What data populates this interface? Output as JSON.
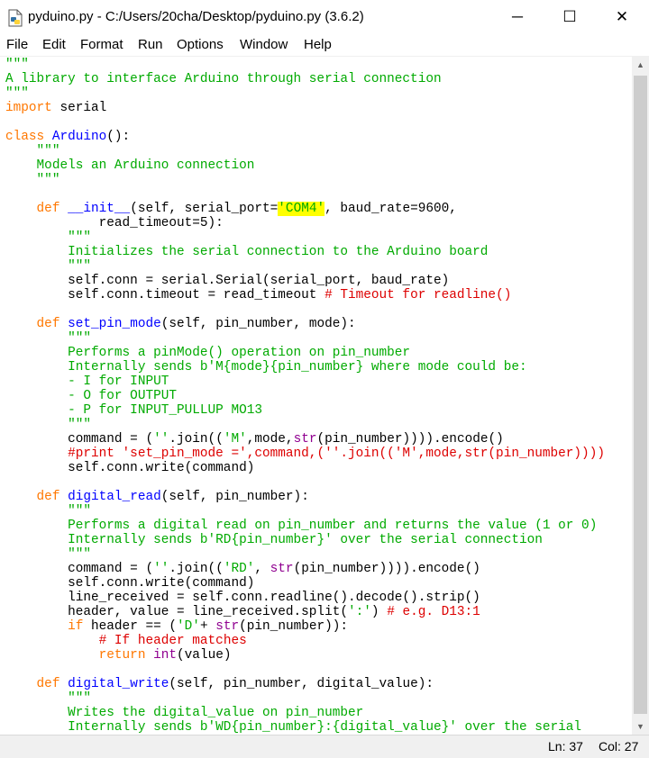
{
  "window": {
    "title": "pyduino.py - C:/Users/20cha/Desktop/pyduino.py (3.6.2)",
    "minimize": "─",
    "maximize": "☐",
    "close": "✕"
  },
  "menu": [
    "File",
    "Edit",
    "Format",
    "Run",
    "Options",
    "Window",
    "Help"
  ],
  "status": {
    "line": "Ln: 37",
    "col": "Col: 27"
  },
  "colors": {
    "string": "#00aa00",
    "keyword": "#ff7700",
    "definition": "#0000ff",
    "builtin": "#900090",
    "comment": "#dd0000",
    "highlight": "#ffff00"
  },
  "code_lines": [
    [
      [
        "s",
        "\"\"\""
      ]
    ],
    [
      [
        "s",
        "A library to interface Arduino through serial connection"
      ]
    ],
    [
      [
        "s",
        "\"\"\""
      ]
    ],
    [
      [
        "k",
        "import"
      ],
      [
        "n",
        " serial"
      ]
    ],
    [],
    [
      [
        "k",
        "class"
      ],
      [
        "n",
        " "
      ],
      [
        "d",
        "Arduino"
      ],
      [
        "n",
        "():"
      ]
    ],
    [
      [
        "n",
        "    "
      ],
      [
        "s",
        "\"\"\""
      ]
    ],
    [
      [
        "n",
        "    "
      ],
      [
        "s",
        "Models an Arduino connection"
      ]
    ],
    [
      [
        "n",
        "    "
      ],
      [
        "s",
        "\"\"\""
      ]
    ],
    [],
    [
      [
        "n",
        "    "
      ],
      [
        "k",
        "def"
      ],
      [
        "n",
        " "
      ],
      [
        "d",
        "__init__"
      ],
      [
        "n",
        "(self, serial_port="
      ],
      [
        "hs",
        "'COM4'"
      ],
      [
        "n",
        ", baud_rate=9600,"
      ]
    ],
    [
      [
        "n",
        "            read_timeout=5):"
      ]
    ],
    [
      [
        "n",
        "        "
      ],
      [
        "s",
        "\"\"\""
      ]
    ],
    [
      [
        "n",
        "        "
      ],
      [
        "s",
        "Initializes the serial connection to the Arduino board"
      ]
    ],
    [
      [
        "n",
        "        "
      ],
      [
        "s",
        "\"\"\""
      ]
    ],
    [
      [
        "n",
        "        self.conn = serial.Serial(serial_port, baud_rate)"
      ]
    ],
    [
      [
        "n",
        "        self.conn.timeout = read_timeout "
      ],
      [
        "c",
        "# Timeout for readline()"
      ]
    ],
    [],
    [
      [
        "n",
        "    "
      ],
      [
        "k",
        "def"
      ],
      [
        "n",
        " "
      ],
      [
        "d",
        "set_pin_mode"
      ],
      [
        "n",
        "(self, pin_number, mode):"
      ]
    ],
    [
      [
        "n",
        "        "
      ],
      [
        "s",
        "\"\"\""
      ]
    ],
    [
      [
        "n",
        "        "
      ],
      [
        "s",
        "Performs a pinMode() operation on pin_number"
      ]
    ],
    [
      [
        "n",
        "        "
      ],
      [
        "s",
        "Internally sends b'M{mode}{pin_number} where mode could be:"
      ]
    ],
    [
      [
        "n",
        "        "
      ],
      [
        "s",
        "- I for INPUT"
      ]
    ],
    [
      [
        "n",
        "        "
      ],
      [
        "s",
        "- O for OUTPUT"
      ]
    ],
    [
      [
        "n",
        "        "
      ],
      [
        "s",
        "- P for INPUT_PULLUP MO13"
      ]
    ],
    [
      [
        "n",
        "        "
      ],
      [
        "s",
        "\"\"\""
      ]
    ],
    [
      [
        "n",
        "        command = ("
      ],
      [
        "s",
        "''"
      ],
      [
        "n",
        ".join(("
      ],
      [
        "s",
        "'M'"
      ],
      [
        "n",
        ",mode,"
      ],
      [
        "b",
        "str"
      ],
      [
        "n",
        "(pin_number)))).encode()"
      ]
    ],
    [
      [
        "n",
        "        "
      ],
      [
        "c",
        "#print 'set_pin_mode =',command,(''.join(('M',mode,str(pin_number))))"
      ]
    ],
    [
      [
        "n",
        "        self.conn.write(command)"
      ]
    ],
    [],
    [
      [
        "n",
        "    "
      ],
      [
        "k",
        "def"
      ],
      [
        "n",
        " "
      ],
      [
        "d",
        "digital_read"
      ],
      [
        "n",
        "(self, pin_number):"
      ]
    ],
    [
      [
        "n",
        "        "
      ],
      [
        "s",
        "\"\"\""
      ]
    ],
    [
      [
        "n",
        "        "
      ],
      [
        "s",
        "Performs a digital read on pin_number and returns the value (1 or 0)"
      ]
    ],
    [
      [
        "n",
        "        "
      ],
      [
        "s",
        "Internally sends b'RD{pin_number}' over the serial connection"
      ]
    ],
    [
      [
        "n",
        "        "
      ],
      [
        "s",
        "\"\"\""
      ]
    ],
    [
      [
        "n",
        "        command = ("
      ],
      [
        "s",
        "''"
      ],
      [
        "n",
        ".join(("
      ],
      [
        "s",
        "'RD'"
      ],
      [
        "n",
        ", "
      ],
      [
        "b",
        "str"
      ],
      [
        "n",
        "(pin_number)))).encode()"
      ]
    ],
    [
      [
        "n",
        "        self.conn.write(command)"
      ]
    ],
    [
      [
        "n",
        "        line_received = self.conn.readline().decode().strip()"
      ]
    ],
    [
      [
        "n",
        "        header, value = line_received.split("
      ],
      [
        "s",
        "':'"
      ],
      [
        "n",
        ") "
      ],
      [
        "c",
        "# e.g. D13:1"
      ]
    ],
    [
      [
        "n",
        "        "
      ],
      [
        "k",
        "if"
      ],
      [
        "n",
        " header == ("
      ],
      [
        "s",
        "'D'"
      ],
      [
        "n",
        "+ "
      ],
      [
        "b",
        "str"
      ],
      [
        "n",
        "(pin_number)):"
      ]
    ],
    [
      [
        "n",
        "            "
      ],
      [
        "c",
        "# If header matches"
      ]
    ],
    [
      [
        "n",
        "            "
      ],
      [
        "k",
        "return"
      ],
      [
        "n",
        " "
      ],
      [
        "b",
        "int"
      ],
      [
        "n",
        "(value)"
      ]
    ],
    [],
    [
      [
        "n",
        "    "
      ],
      [
        "k",
        "def"
      ],
      [
        "n",
        " "
      ],
      [
        "d",
        "digital_write"
      ],
      [
        "n",
        "(self, pin_number, digital_value):"
      ]
    ],
    [
      [
        "n",
        "        "
      ],
      [
        "s",
        "\"\"\""
      ]
    ],
    [
      [
        "n",
        "        "
      ],
      [
        "s",
        "Writes the digital_value on pin_number"
      ]
    ],
    [
      [
        "n",
        "        "
      ],
      [
        "s",
        "Internally sends b'WD{pin_number}:{digital_value}' over the serial"
      ]
    ]
  ]
}
